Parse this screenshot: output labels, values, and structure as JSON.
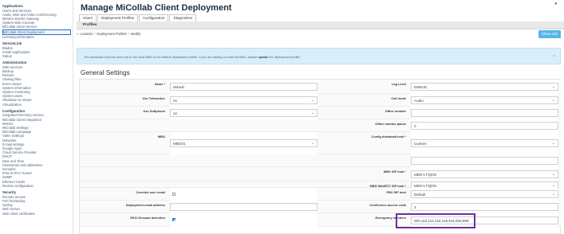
{
  "sidebar": {
    "sections": [
      {
        "title": "Applications",
        "items": [
          "Users and Services",
          "Audio, Web and Video Conferencing",
          "MiVoice Border Gateway",
          "System Web Console",
          "MiCollab Client Service",
          "MiCollab Client Deployment",
          "Licensing Information"
        ],
        "active_index": 5
      },
      {
        "title": "ServiceLink",
        "items": [
          "Blades",
          "Install Applications",
          "Status"
        ]
      },
      {
        "title": "Administration",
        "items": [
          "Web services",
          "Backup",
          "Restore",
          "Viewing files",
          "Event viewer",
          "System information",
          "System monitoring",
          "System users",
          "Shutdown or reboot",
          "Virtualization"
        ]
      },
      {
        "title": "Configuration",
        "items": [
          "Integrated Directory Service",
          "MiCollab Client Integration",
          "MiSSO",
          "MiCollab Settings",
          "MiCollab Language",
          "Video Settings",
          "Networks",
          "E-mail settings",
          "Google Apps",
          "Cloud Service Provider",
          "DHCP",
          "Date and Time",
          "Hostnames and addresses",
          "Domains",
          "IPv6-in-IPv4 Tunnel",
          "SNMP",
          "Ethernet Cards",
          "Review configuration"
        ]
      },
      {
        "title": "Security",
        "items": [
          "Remote access",
          "Port forwarding",
          "Syslog",
          "Web Server",
          "Web client certificates"
        ]
      }
    ]
  },
  "header": {
    "title": "Manage MiCollab Client Deployment",
    "corner_icon": "help-icon",
    "tabs": [
      "Users",
      "Deployment Profiles",
      "Configuration",
      "Diagnostics"
    ],
    "active_tab": 1,
    "subheader": "Profiles"
  },
  "breadcrumb": {
    "prefix": "»",
    "items": [
      "Location",
      "Deployment Profiles",
      "Modify"
    ]
  },
  "show_info_label": "Show Info",
  "alert": {
    "text_before": "The download host has been set to the local MBG in the default deployment profile.  If you are adding an external MBG, please ",
    "bold_word": "update",
    "text_after": " the deployment profile.",
    "close": "×"
  },
  "section_title": "General Settings",
  "left_fields": [
    {
      "label": "Name *",
      "type": "text",
      "value": "default"
    },
    {
      "label": "Use Teleworker",
      "type": "select",
      "value": "on"
    },
    {
      "label": "Use Softphone",
      "type": "select",
      "value": "on"
    },
    {
      "label": "",
      "type": "empty",
      "value": ""
    },
    {
      "label": "MBG",
      "type": "select",
      "value": "MBG01"
    },
    {
      "label": "",
      "type": "empty",
      "value": ""
    },
    {
      "label": "",
      "type": "empty",
      "value": ""
    },
    {
      "label": "",
      "type": "empty",
      "value": ""
    },
    {
      "label": "Override user email",
      "type": "checkbox",
      "checked": false
    },
    {
      "label": "Deployment email address",
      "type": "text",
      "value": ""
    },
    {
      "label": "E911 Geocast detection",
      "type": "checkbox",
      "checked": true
    }
  ],
  "right_fields": [
    {
      "label": "Log Level",
      "type": "select",
      "value": "DEBUG"
    },
    {
      "label": "Call mode",
      "type": "select",
      "value": "Audio"
    },
    {
      "label": "Office number",
      "type": "text",
      "value": ""
    },
    {
      "label": "Office number pause",
      "type": "text",
      "value": "0"
    },
    {
      "label": "Config download host *",
      "type": "select",
      "value": "Custom"
    },
    {
      "label": "",
      "type": "text",
      "value": ""
    },
    {
      "label": "MBG SIP host *",
      "type": "select",
      "value": "MBG's FQDN"
    },
    {
      "label": "MBG WebRTC SIP host *",
      "type": "select",
      "value": "MBG's FQDN"
    },
    {
      "label": "PBX SIP host",
      "type": "select",
      "value": "Default"
    },
    {
      "label": "Conference access code",
      "type": "text",
      "value": "3"
    },
    {
      "label": "Emergency numbers",
      "type": "text",
      "value": "000,110,112,118,119,911,933,999"
    }
  ],
  "colors": {
    "accent": "#2d6db5",
    "info_button": "#55b6e8",
    "alert_bg": "#d9eef9",
    "highlight": "#6b2fa3"
  }
}
